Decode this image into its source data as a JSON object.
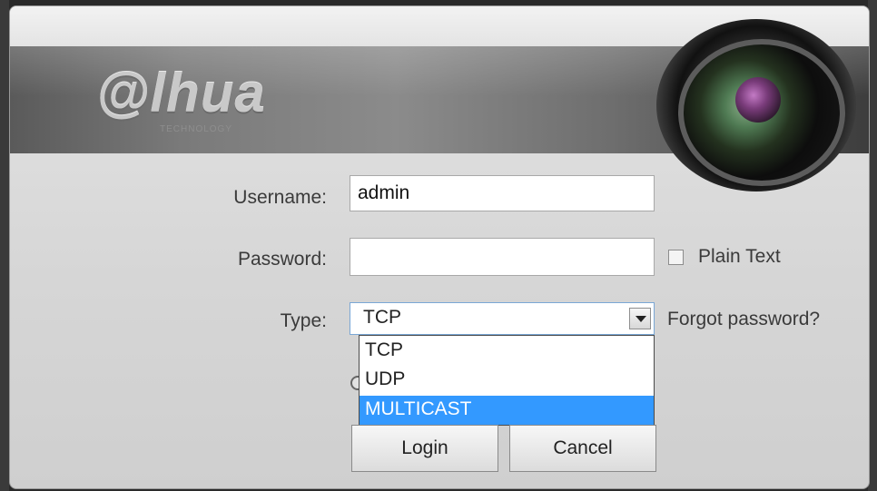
{
  "brand": {
    "logo_text": "@lhua",
    "logo_sub": "TECHNOLOGY"
  },
  "form": {
    "username_label": "Username:",
    "username_value": "admin",
    "password_label": "Password:",
    "password_value": "",
    "plain_text_label": "Plain Text",
    "plain_text_checked": false,
    "type_label": "Type:",
    "type_value": "TCP",
    "forgot_label": "Forgot password?",
    "type_options": [
      "TCP",
      "UDP",
      "MULTICAST"
    ],
    "highlighted_option": "MULTICAST"
  },
  "buttons": {
    "login_label": "Login",
    "cancel_label": "Cancel"
  },
  "colors": {
    "highlight": "#3399ff",
    "select_border": "#7aa7d6"
  }
}
